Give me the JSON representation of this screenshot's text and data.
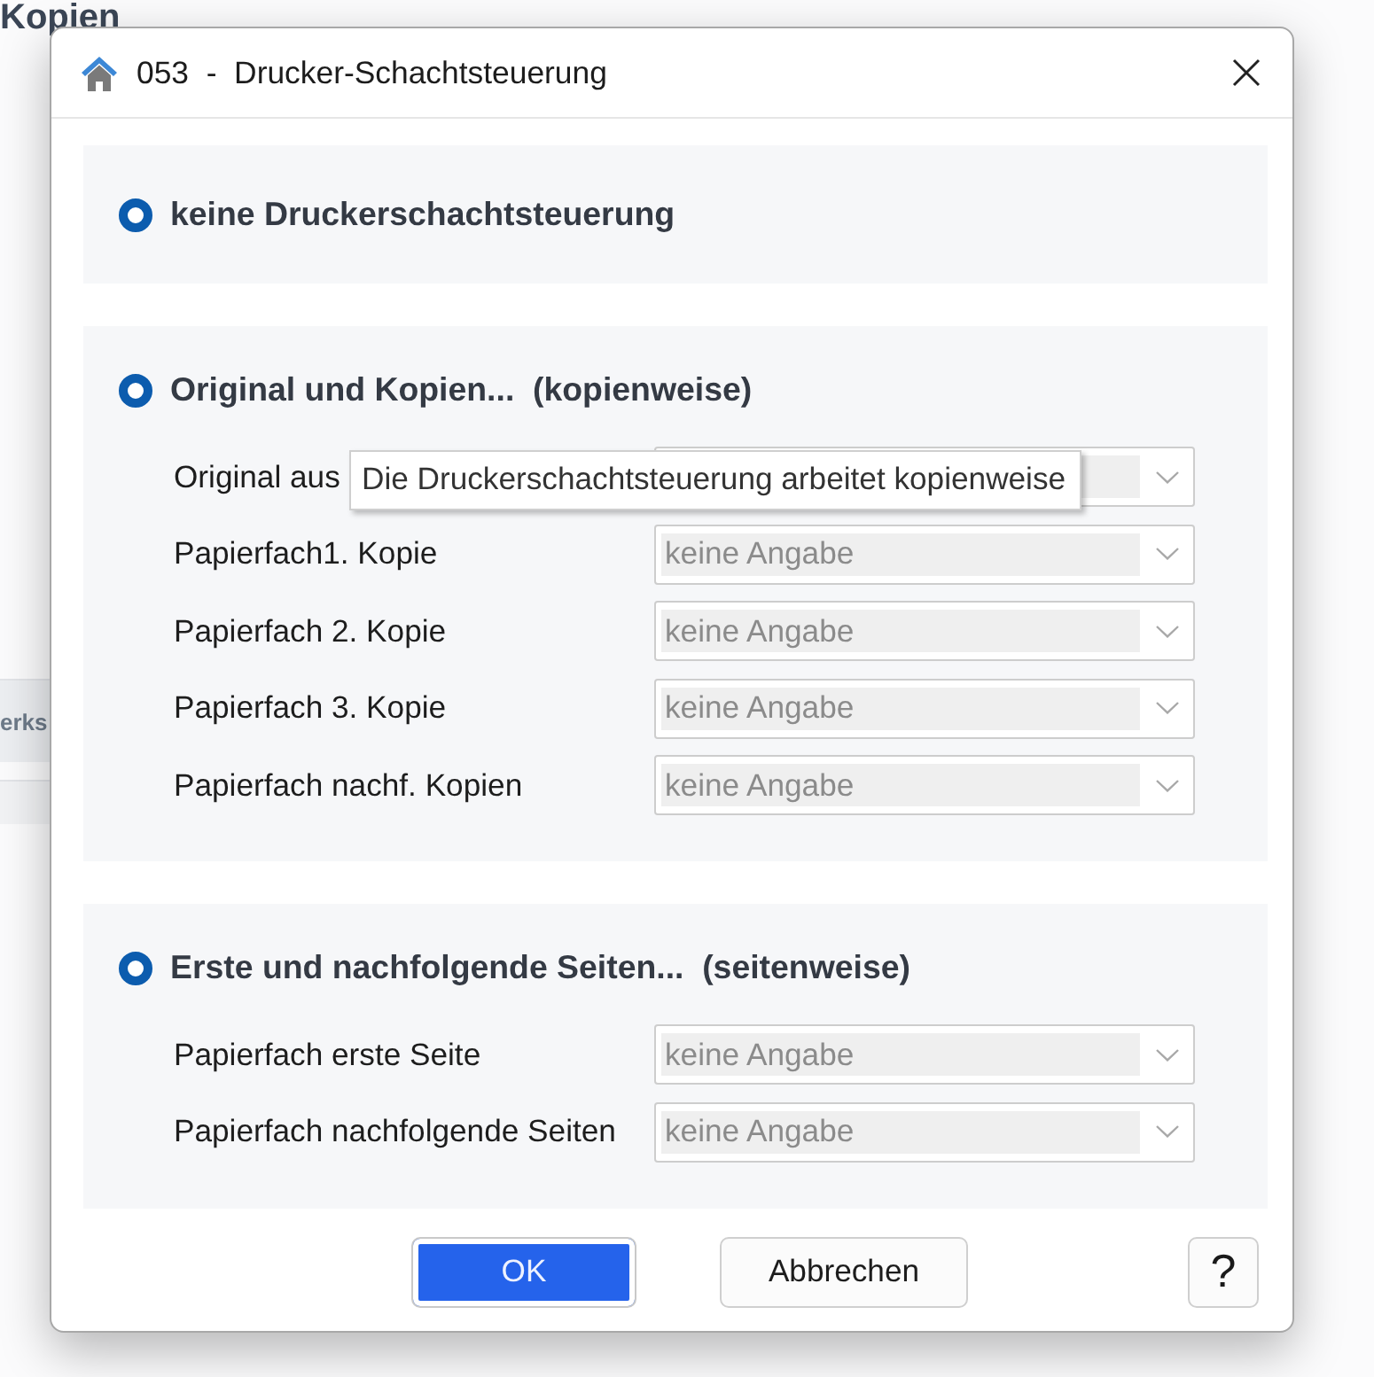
{
  "background": {
    "heading": "Kopien",
    "row_label": "erks"
  },
  "window": {
    "title": "053  -  Drucker-Schachtsteuerung"
  },
  "options": [
    {
      "label": "keine Druckerschachtsteuerung",
      "selected": true
    },
    {
      "label": "Original und Kopien...  (kopienweise)",
      "selected": true,
      "fields": [
        {
          "label": "Original aus",
          "disabled": true
        },
        {
          "label": "Papierfach1. Kopie",
          "value": "keine Angabe",
          "disabled": true
        },
        {
          "label": "Papierfach 2. Kopie",
          "value": "keine Angabe",
          "disabled": true
        },
        {
          "label": "Papierfach 3. Kopie",
          "value": "keine Angabe",
          "disabled": true
        },
        {
          "label": "Papierfach nachf. Kopien",
          "value": "keine Angabe",
          "disabled": true
        }
      ]
    },
    {
      "label": "Erste und nachfolgende Seiten...  (seitenweise)",
      "selected": true,
      "fields": [
        {
          "label": "Papierfach erste Seite",
          "value": "keine Angabe",
          "disabled": true
        },
        {
          "label": "Papierfach nachfolgende Seiten",
          "value": "keine Angabe",
          "disabled": true
        }
      ]
    }
  ],
  "tooltip": {
    "text": "Die Druckerschachtsteuerung arbeitet kopienweise"
  },
  "buttons": [
    {
      "label": "OK",
      "kind": "primary"
    },
    {
      "label": "Abbrechen",
      "kind": "default"
    },
    {
      "label": "?",
      "kind": "help"
    }
  ]
}
